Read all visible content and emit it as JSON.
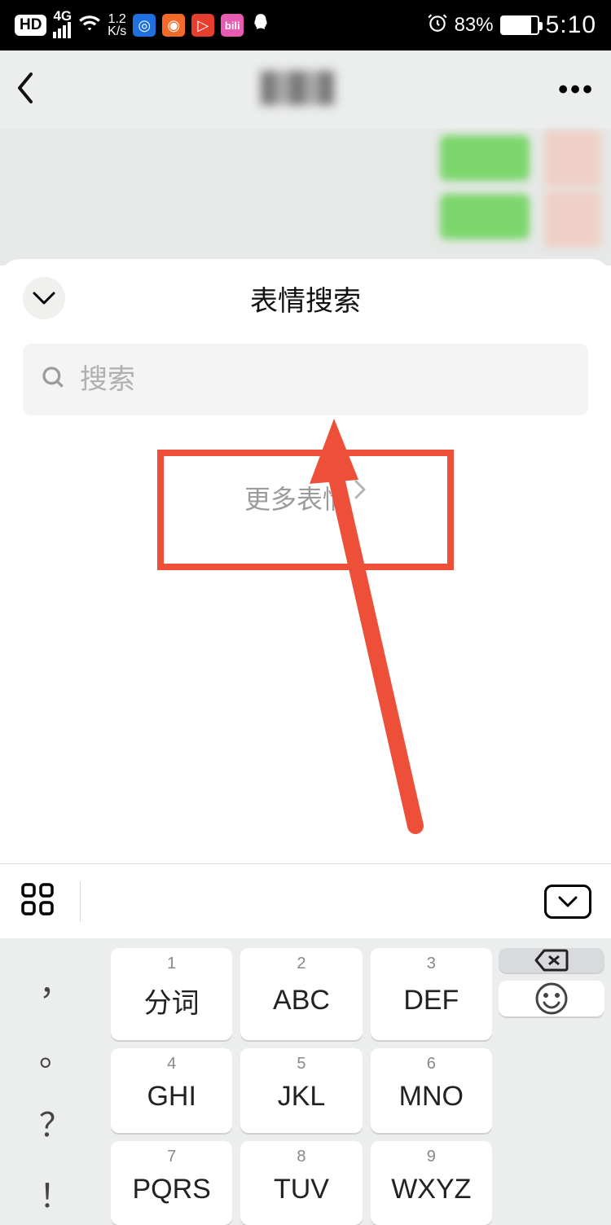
{
  "status": {
    "hd": "HD",
    "net_label": "4G",
    "speed_top": "1.2",
    "speed_bottom": "K/s",
    "battery_pct": "83%",
    "clock": "5:10"
  },
  "nav": {},
  "sheet": {
    "title": "表情搜索",
    "search_placeholder": "搜索",
    "more_label": "更多表情"
  },
  "keyboard": {
    "puncts": [
      "，",
      "。",
      "？",
      "！"
    ],
    "keys": [
      {
        "num": "1",
        "lab": "分词"
      },
      {
        "num": "2",
        "lab": "ABC"
      },
      {
        "num": "3",
        "lab": "DEF"
      },
      {
        "num": "4",
        "lab": "GHI"
      },
      {
        "num": "5",
        "lab": "JKL"
      },
      {
        "num": "6",
        "lab": "MNO"
      },
      {
        "num": "7",
        "lab": "PQRS"
      },
      {
        "num": "8",
        "lab": "TUV"
      },
      {
        "num": "9",
        "lab": "WXYZ"
      }
    ]
  }
}
